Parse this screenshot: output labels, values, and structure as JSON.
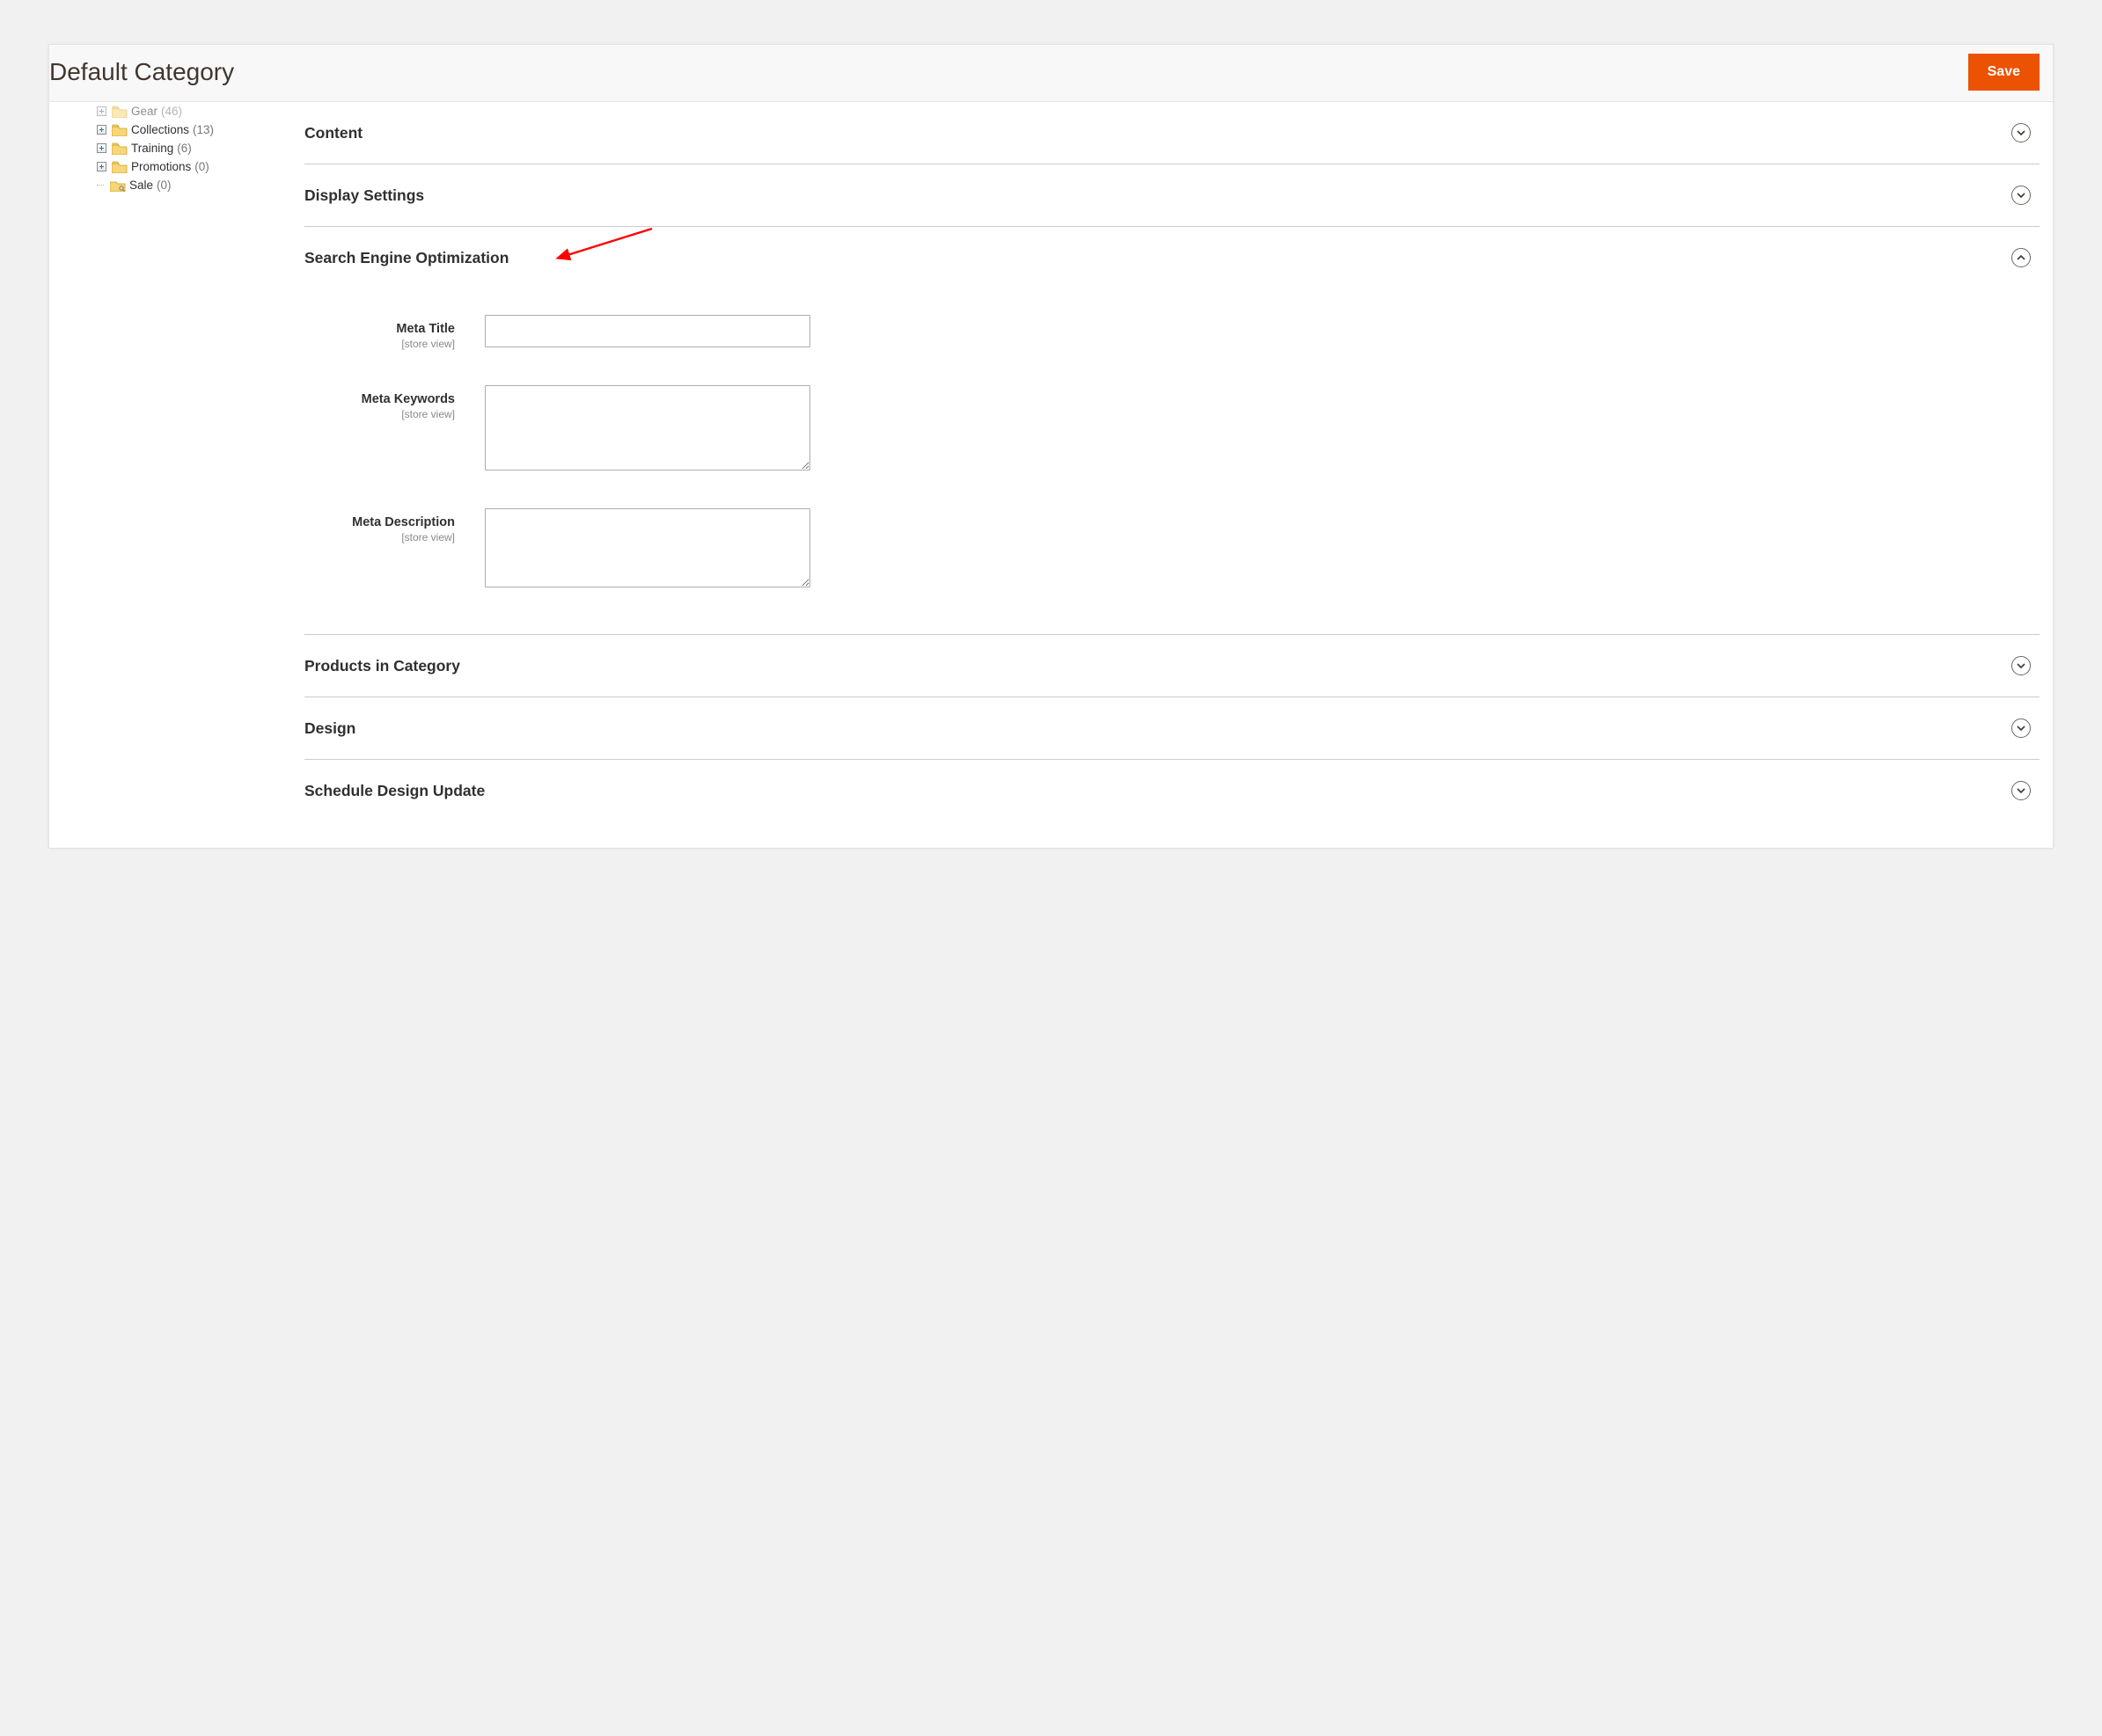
{
  "header": {
    "title": "Default Category",
    "save_label": "Save"
  },
  "sidebar": {
    "items": [
      {
        "label": "Gear",
        "count": "(46)",
        "expandable": true,
        "cut": true
      },
      {
        "label": "Collections",
        "count": "(13)",
        "expandable": true,
        "cut": false
      },
      {
        "label": "Training",
        "count": "(6)",
        "expandable": true,
        "cut": false
      },
      {
        "label": "Promotions",
        "count": "(0)",
        "expandable": true,
        "cut": false
      },
      {
        "label": "Sale",
        "count": "(0)",
        "expandable": false,
        "cut": false
      }
    ]
  },
  "sections": {
    "content": {
      "title": "Content",
      "expanded": false
    },
    "display": {
      "title": "Display Settings",
      "expanded": false
    },
    "seo": {
      "title": "Search Engine Optimization",
      "expanded": true,
      "fields": {
        "meta_title": {
          "label": "Meta Title",
          "scope": "[store view]",
          "value": ""
        },
        "meta_keywords": {
          "label": "Meta Keywords",
          "scope": "[store view]",
          "value": ""
        },
        "meta_description": {
          "label": "Meta Description",
          "scope": "[store view]",
          "value": ""
        }
      }
    },
    "products": {
      "title": "Products in Category",
      "expanded": false
    },
    "design": {
      "title": "Design",
      "expanded": false
    },
    "schedule": {
      "title": "Schedule Design Update",
      "expanded": false
    }
  }
}
